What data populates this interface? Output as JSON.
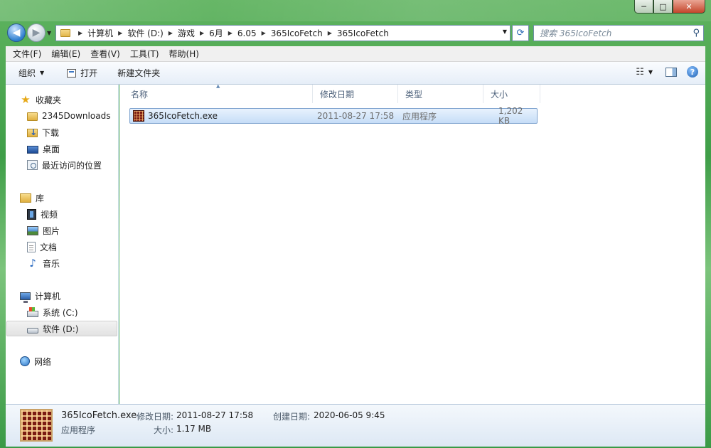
{
  "window": {
    "caption": {
      "minimize": "─",
      "maximize": "□",
      "close": "✕"
    }
  },
  "nav": {
    "back_glyph": "◀",
    "forward_glyph": "▶",
    "breadcrumbs": [
      "计算机",
      "软件 (D:)",
      "游戏",
      "6月",
      "6.05",
      "365IcoFetch",
      "365IcoFetch"
    ],
    "search_placeholder": "搜索 365IcoFetch"
  },
  "menu": [
    "文件(F)",
    "编辑(E)",
    "查看(V)",
    "工具(T)",
    "帮助(H)"
  ],
  "commands": {
    "organize": "组织",
    "open": "打开",
    "new_folder": "新建文件夹",
    "help_glyph": "?"
  },
  "sidebar": {
    "favorites": {
      "title": "收藏夹",
      "items": [
        "2345Downloads",
        "下载",
        "桌面",
        "最近访问的位置"
      ]
    },
    "libraries": {
      "title": "库",
      "items": [
        "视频",
        "图片",
        "文档",
        "音乐"
      ]
    },
    "computer": {
      "title": "计算机",
      "items": [
        "系统 (C:)",
        "软件 (D:)"
      ],
      "selected": "软件 (D:)"
    },
    "network": {
      "title": "网络"
    }
  },
  "columns": [
    "名称",
    "修改日期",
    "类型",
    "大小"
  ],
  "files": [
    {
      "name": "365IcoFetch.exe",
      "modified": "2011-08-27 17:58",
      "type": "应用程序",
      "size": "1,202 KB",
      "icon": "exe-icon",
      "selected": true
    }
  ],
  "details": {
    "filename": "365IcoFetch.exe",
    "filetype": "应用程序",
    "modified_label": "修改日期:",
    "modified_value": "2011-08-27 17:58",
    "created_label": "创建日期:",
    "created_value": "2020-06-05 9:45",
    "size_label": "大小:",
    "size_value": "1.17 MB"
  },
  "colors": {
    "selection_bg": "#cce4fb",
    "selection_border": "#7da2ce",
    "header_text": "#4c607a",
    "frame_glass": "#3f9e48"
  }
}
